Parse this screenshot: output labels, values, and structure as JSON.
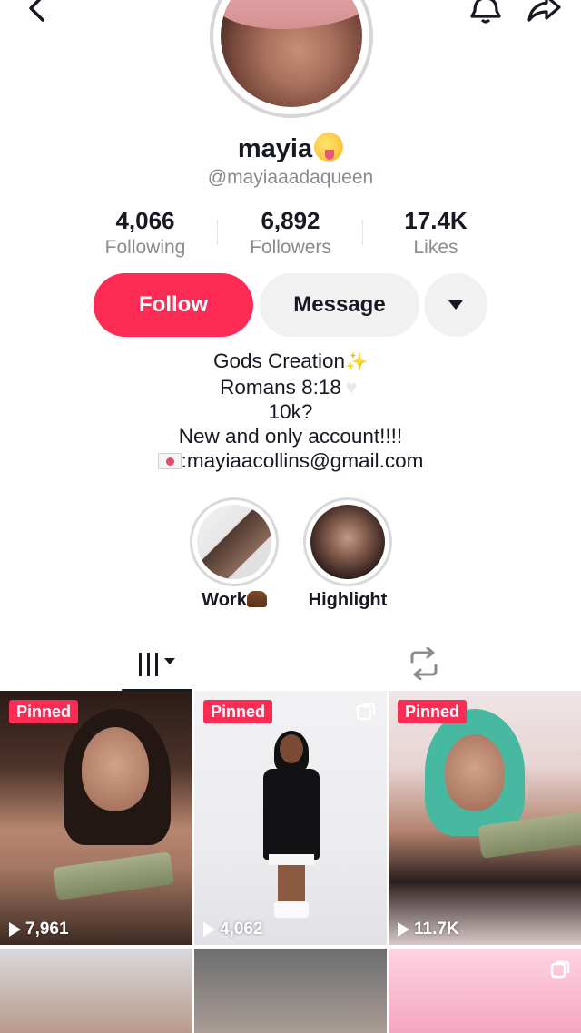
{
  "profile": {
    "display_name": "mayia",
    "handle": "@mayiaaadaqueen",
    "stats": [
      {
        "value": "4,066",
        "label": "Following"
      },
      {
        "value": "6,892",
        "label": "Followers"
      },
      {
        "value": "17.4K",
        "label": "Likes"
      }
    ]
  },
  "actions": {
    "follow_label": "Follow",
    "message_label": "Message"
  },
  "bio": {
    "line1": "Gods Creation",
    "line2": "Romans 8:18",
    "line3": "10k?",
    "line4": "New and only account!!!!",
    "line5": ":mayiaacollins@gmail.com"
  },
  "highlights": [
    {
      "label": "Work"
    },
    {
      "label": "Highlight"
    }
  ],
  "videos": [
    {
      "pinned": "Pinned",
      "views": "7,961"
    },
    {
      "pinned": "Pinned",
      "views": "4,062"
    },
    {
      "pinned": "Pinned",
      "views": "11.7K"
    }
  ],
  "colors": {
    "accent": "#fe2c55",
    "text": "#161823",
    "muted": "#8a8b91"
  },
  "icons": [
    "back-arrow-icon",
    "bell-icon",
    "share-icon",
    "dropdown-caret-icon",
    "grid-tab-icon",
    "repost-tab-icon",
    "play-icon",
    "multi-photo-icon"
  ]
}
